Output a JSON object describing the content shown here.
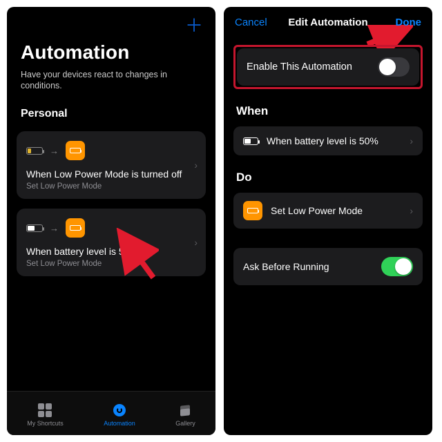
{
  "left": {
    "plus_glyph": "＋",
    "title": "Automation",
    "subtitle": "Have your devices react to changes in conditions.",
    "section": "Personal",
    "cards": [
      {
        "transition_arrow": "→",
        "title": "When Low Power Mode is turned off",
        "subtitle": "Set Low Power Mode"
      },
      {
        "transition_arrow": "→",
        "title": "When battery level is 50%",
        "subtitle": "Set Low Power Mode"
      }
    ],
    "tabs": {
      "shortcuts": "My Shortcuts",
      "automation": "Automation",
      "gallery": "Gallery"
    }
  },
  "right": {
    "cancel": "Cancel",
    "title": "Edit Automation",
    "done": "Done",
    "enable_label": "Enable This Automation",
    "enable_on": false,
    "when_header": "When",
    "when_row": "When battery level is 50%",
    "do_header": "Do",
    "do_row": "Set Low Power Mode",
    "ask_label": "Ask Before Running",
    "ask_on": true
  },
  "chev": "›"
}
